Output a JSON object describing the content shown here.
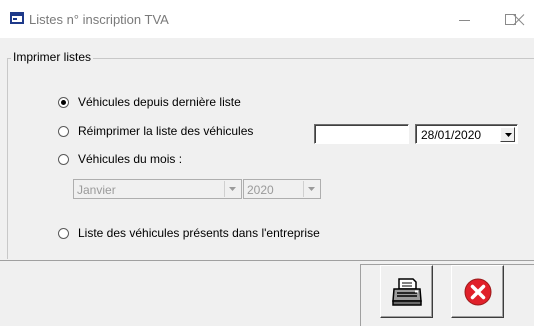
{
  "window": {
    "title": "Listes n° inscription TVA",
    "icon": "form-window-icon",
    "controls": [
      "minimize-icon",
      "maximize-icon",
      "close-icon"
    ]
  },
  "group": {
    "label": "Imprimer listes"
  },
  "options": [
    {
      "label": "Véhicules depuis dernière liste",
      "checked": true
    },
    {
      "label": "Réimprimer la liste des véhicules",
      "checked": false
    },
    {
      "label": "Véhicules du mois :",
      "checked": false
    },
    {
      "label": "Liste des véhicules présents dans l'entreprise",
      "checked": false
    }
  ],
  "reprint": {
    "number_value": "",
    "date_value": "28/01/2020"
  },
  "month_select": {
    "month": "Janvier",
    "year": "2020",
    "enabled": false
  },
  "actions": {
    "print": "printer-icon",
    "cancel": "cancel-x-icon"
  },
  "colors": {
    "cancel_red": "#e0202a",
    "disabled_text": "#9a9a9a"
  }
}
